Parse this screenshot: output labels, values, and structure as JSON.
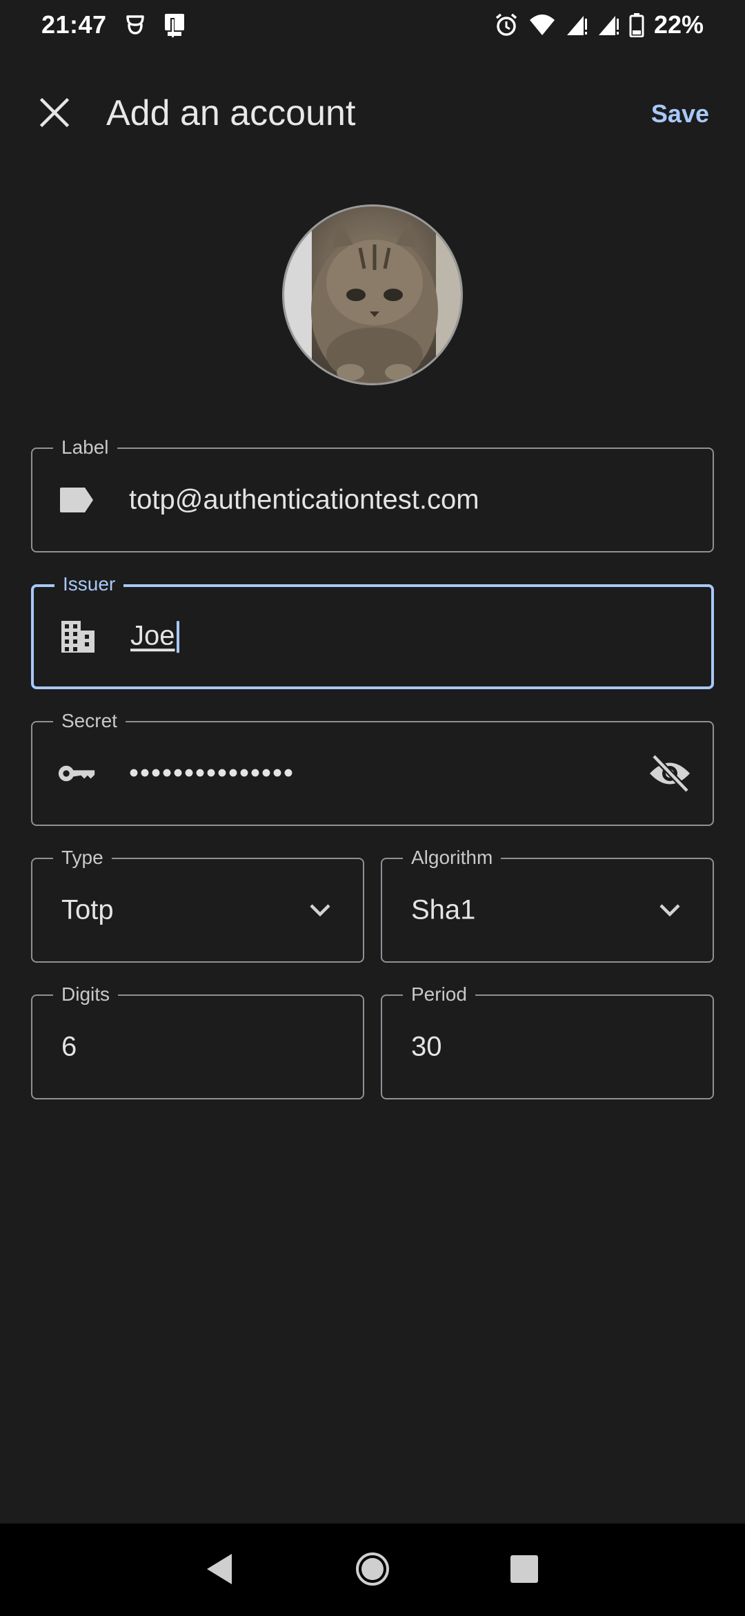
{
  "status_bar": {
    "time": "21:47",
    "battery": "22%",
    "icons": [
      "data-saver-icon",
      "device-icon",
      "alarm-icon",
      "wifi-icon",
      "signal-icon",
      "signal-icon",
      "battery-icon"
    ]
  },
  "app_bar": {
    "title": "Add an account",
    "save_label": "Save",
    "close_icon": "close-icon"
  },
  "avatar": {
    "description_icon": "account-icon-image"
  },
  "form": {
    "label": {
      "label": "Label",
      "value": "totp@authenticationtest.com",
      "icon": "label-tag-icon"
    },
    "issuer": {
      "label": "Issuer",
      "value": "Joe",
      "icon": "domain-building-icon"
    },
    "secret": {
      "label": "Secret",
      "value": "•••••••••••••••",
      "icon": "key-icon",
      "toggle_icon": "visibility-off-icon"
    },
    "type": {
      "label": "Type",
      "value": "Totp"
    },
    "algorithm": {
      "label": "Algorithm",
      "value": "Sha1"
    },
    "digits": {
      "label": "Digits",
      "value": "6"
    },
    "period": {
      "label": "Period",
      "value": "30"
    }
  },
  "colors": {
    "background": "#1c1c1d",
    "accent": "#a8c8f8",
    "outline": "#8f9196"
  }
}
